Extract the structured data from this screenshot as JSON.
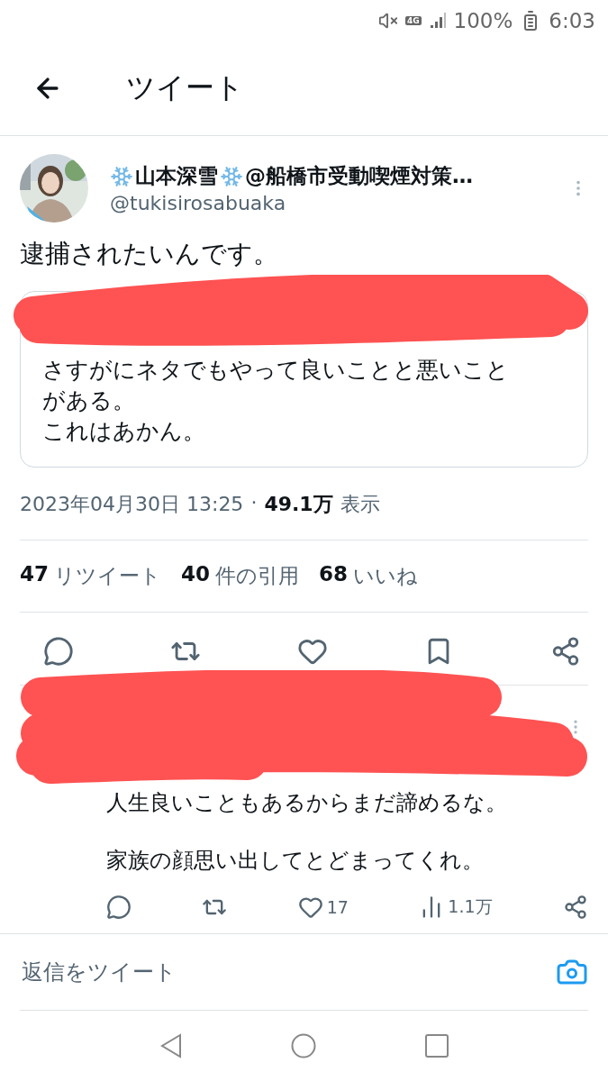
{
  "status_bar": {
    "network": "4G",
    "battery": "100%",
    "time": "6:03"
  },
  "header": {
    "title": "ツイート"
  },
  "tweet": {
    "display_name": "山本深雪",
    "name_suffix": "@船橋市受動喫煙対策…",
    "handle": "@tukisirosabuaka",
    "text": "逮捕されたいんです。",
    "quote": {
      "paragraphs": [
        "さすがにネタでもやって良いことと悪いことがある。",
        "これはあかん。"
      ]
    },
    "timestamp": "2023年04月30日 13:25",
    "separator": "·",
    "views_count": "49.1万",
    "views_label": "表示",
    "stats": [
      {
        "count": "47",
        "label": "リツイート"
      },
      {
        "count": "40",
        "label": "件の引用"
      },
      {
        "count": "68",
        "label": "いいね"
      }
    ],
    "actions": [
      {
        "kind": "reply"
      },
      {
        "kind": "retweet"
      },
      {
        "kind": "like"
      },
      {
        "kind": "bookmark"
      },
      {
        "kind": "share"
      }
    ]
  },
  "reply": {
    "paragraphs": [
      "人生良いこともあるからまだ諦めるな。",
      "家族の顔思い出してとどまってくれ。"
    ],
    "actions": [
      {
        "kind": "reply"
      },
      {
        "kind": "retweet"
      },
      {
        "kind": "like",
        "count": "17"
      },
      {
        "kind": "views",
        "count": "1.1万"
      },
      {
        "kind": "share"
      }
    ]
  },
  "compose": {
    "placeholder": "返信をツイート"
  }
}
